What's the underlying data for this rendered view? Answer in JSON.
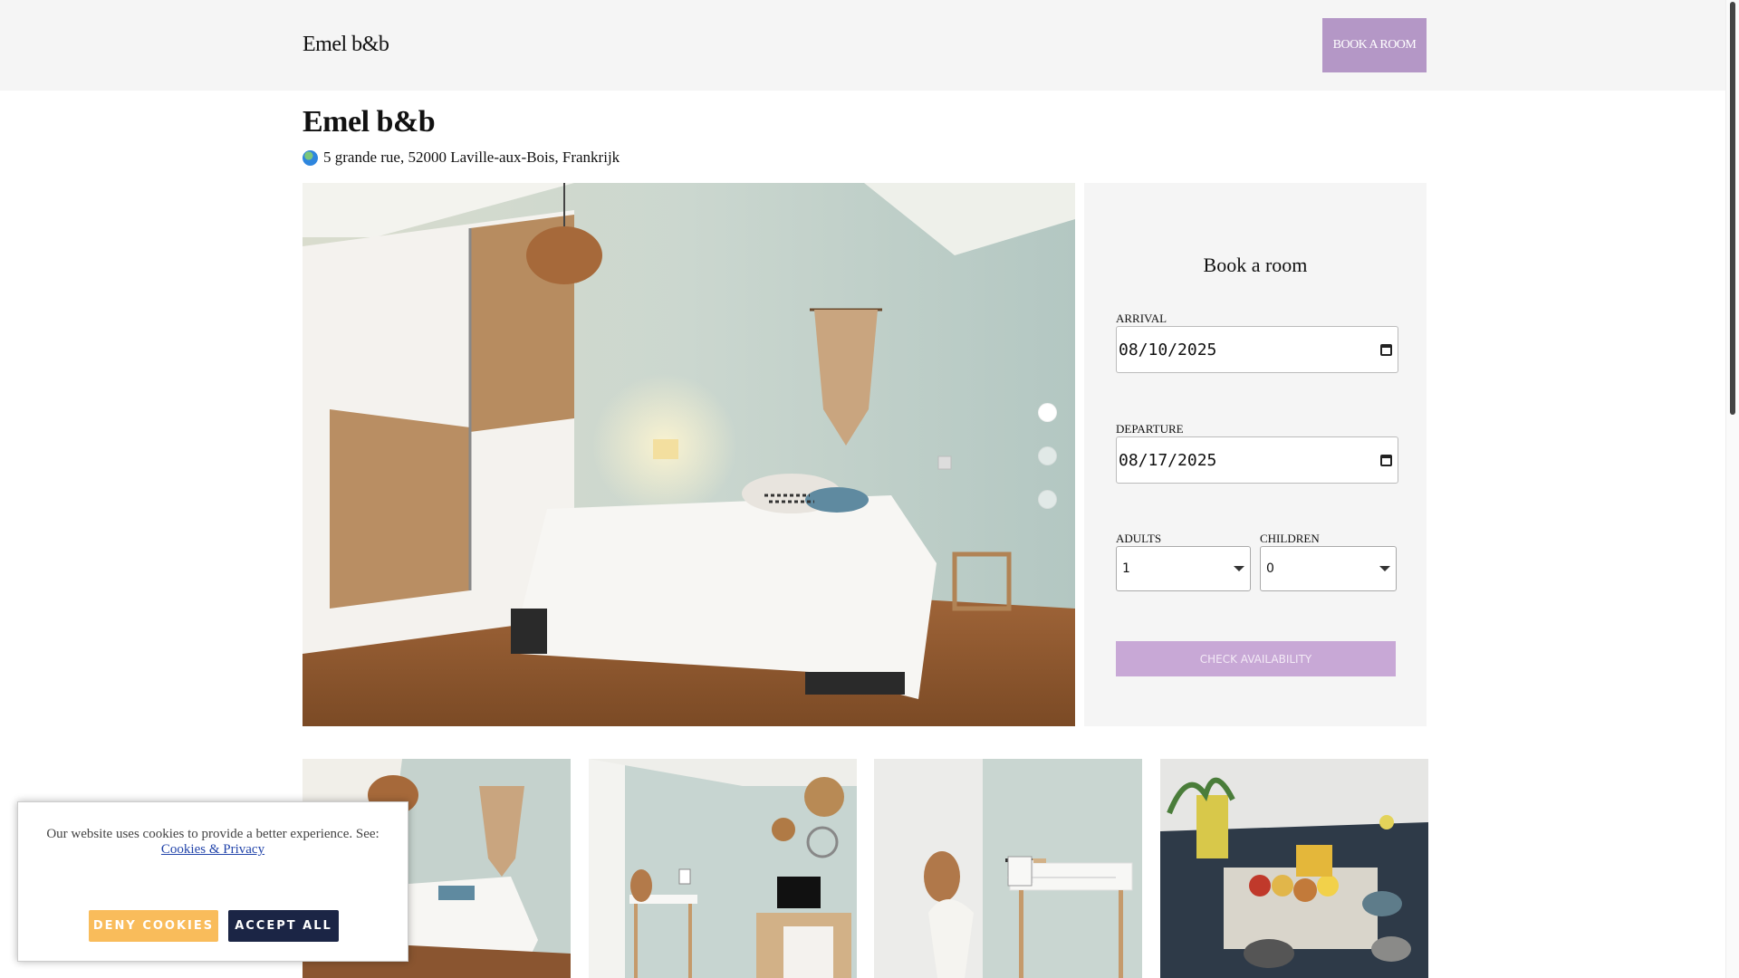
{
  "header": {
    "brand": "Emel b&b",
    "book_button": "BOOK A ROOM"
  },
  "listing": {
    "title": "Emel b&b",
    "address": "5 grande rue, 52000 Laville-aux-Bois, Frankrijk",
    "address_icon": "globe-icon"
  },
  "gallery": {
    "hero_image": "bedroom-photo",
    "carousel_slides": 3,
    "active_slide": 1,
    "thumbnails": [
      "bedroom-photo",
      "desk-tv-photo",
      "desk-lantern-photo",
      "breakfast-table-photo"
    ]
  },
  "booking": {
    "heading": "Book a room",
    "arrival_label": "ARRIVAL",
    "arrival_value": "08/10/2025",
    "departure_label": "DEPARTURE",
    "departure_value": "08/17/2025",
    "adults_label": "ADULTS",
    "adults_value": "1",
    "children_label": "CHILDREN",
    "children_value": "0",
    "check_button": "CHECK AVAILABILITY"
  },
  "cookie_banner": {
    "text": "Our website uses cookies to provide a better experience. See:",
    "link": "Cookies & Privacy",
    "deny_button": "DENY COOKIES",
    "accept_button": "ACCEPT ALL"
  },
  "colors": {
    "accent": "#b497c6",
    "deny": "#f9bc5b",
    "accept": "#1b2545"
  }
}
